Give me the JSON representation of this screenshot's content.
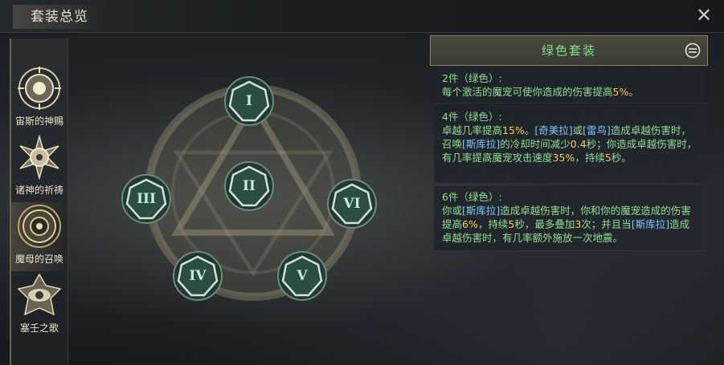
{
  "header": {
    "title": "套装总览",
    "close_icon": "close-x-icon"
  },
  "sidebar": {
    "items": [
      {
        "label": "宙斯的神赐",
        "icon": "sun-emblem-icon",
        "active": false
      },
      {
        "label": "诸神的祈祷",
        "icon": "radiant-star-emblem-icon",
        "active": false
      },
      {
        "label": "魔母的召唤",
        "icon": "spiked-orb-emblem-icon",
        "active": true
      },
      {
        "label": "塞壬之歌",
        "icon": "eye-emblem-icon",
        "active": false
      }
    ]
  },
  "nodes": [
    "I",
    "II",
    "III",
    "IV",
    "V",
    "VI"
  ],
  "panel": {
    "title": "绿色套装",
    "title_color": "#7fe08a",
    "tiers": [
      {
        "head": "2件（绿色）:",
        "segments": [
          {
            "text": "每个激活的魔宠可使你造成的伤害提高",
            "style": "n"
          },
          {
            "text": "5%",
            "style": "hl"
          },
          {
            "text": "。",
            "style": "n"
          }
        ]
      },
      {
        "head": "4件（绿色）:",
        "segments": [
          {
            "text": "卓越几率提高",
            "style": "n"
          },
          {
            "text": "15%",
            "style": "hl"
          },
          {
            "text": "。",
            "style": "n"
          },
          {
            "text": "[奇美拉]",
            "style": "hb"
          },
          {
            "text": "或",
            "style": "n"
          },
          {
            "text": "[雷鸟]",
            "style": "hb"
          },
          {
            "text": "造成卓越伤害时，召唤",
            "style": "n"
          },
          {
            "text": "[斯库拉]",
            "style": "hb"
          },
          {
            "text": "的冷却时间减少",
            "style": "n"
          },
          {
            "text": "0.4",
            "style": "hl"
          },
          {
            "text": "秒；你造成卓越伤害时，有几率提高魔宠攻击速度",
            "style": "n"
          },
          {
            "text": "35%",
            "style": "hl"
          },
          {
            "text": "，持续",
            "style": "n"
          },
          {
            "text": "5",
            "style": "hl"
          },
          {
            "text": "秒。",
            "style": "n"
          }
        ]
      },
      {
        "head": "6件（绿色）:",
        "segments": [
          {
            "text": "你或",
            "style": "n"
          },
          {
            "text": "[斯库拉]",
            "style": "hb"
          },
          {
            "text": "造成卓越伤害时，你和你的魔宠造成的伤害提高",
            "style": "n"
          },
          {
            "text": "6%",
            "style": "hl"
          },
          {
            "text": "，持续",
            "style": "n"
          },
          {
            "text": "5",
            "style": "hl"
          },
          {
            "text": "秒，最多叠加",
            "style": "n"
          },
          {
            "text": "3",
            "style": "hl"
          },
          {
            "text": "次；并且当",
            "style": "n"
          },
          {
            "text": "[斯库拉]",
            "style": "hb"
          },
          {
            "text": "造成卓越伤害时，有几率额外施放一次地震。",
            "style": "n"
          }
        ]
      }
    ]
  }
}
